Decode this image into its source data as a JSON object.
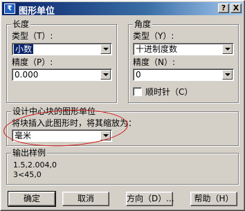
{
  "window": {
    "title": "图形单位",
    "help_button": "?",
    "close_button": "X",
    "app_icon_glyph": "₹"
  },
  "length": {
    "group_label": "长度",
    "type_label": "类型（T）:",
    "type_value": "小数",
    "precision_label": "精度（P）:",
    "precision_value": "0.000"
  },
  "angle": {
    "group_label": "角度",
    "type_label": "类型（Y）:",
    "type_value": "十进制度数",
    "precision_label": "精度（N）:",
    "precision_value": "0",
    "clockwise_label": "顺时针（C）",
    "clockwise_checked": false
  },
  "insertion": {
    "group_label": "设计中心块的图形单位",
    "description": "将块插入此图形时，将其缩放为：",
    "unit_value": "毫米"
  },
  "output_sample": {
    "group_label": "输出样例",
    "lines": [
      "1.5,2.004,0",
      "3<45,0"
    ]
  },
  "buttons": {
    "ok": "确定",
    "cancel": "取消",
    "direction": "方向（D）...",
    "help": "帮助（H）"
  },
  "colors": {
    "title_bar": "#0a246a",
    "dialog_face": "#d4d0c8",
    "annotation_ellipse": "#d01010"
  }
}
